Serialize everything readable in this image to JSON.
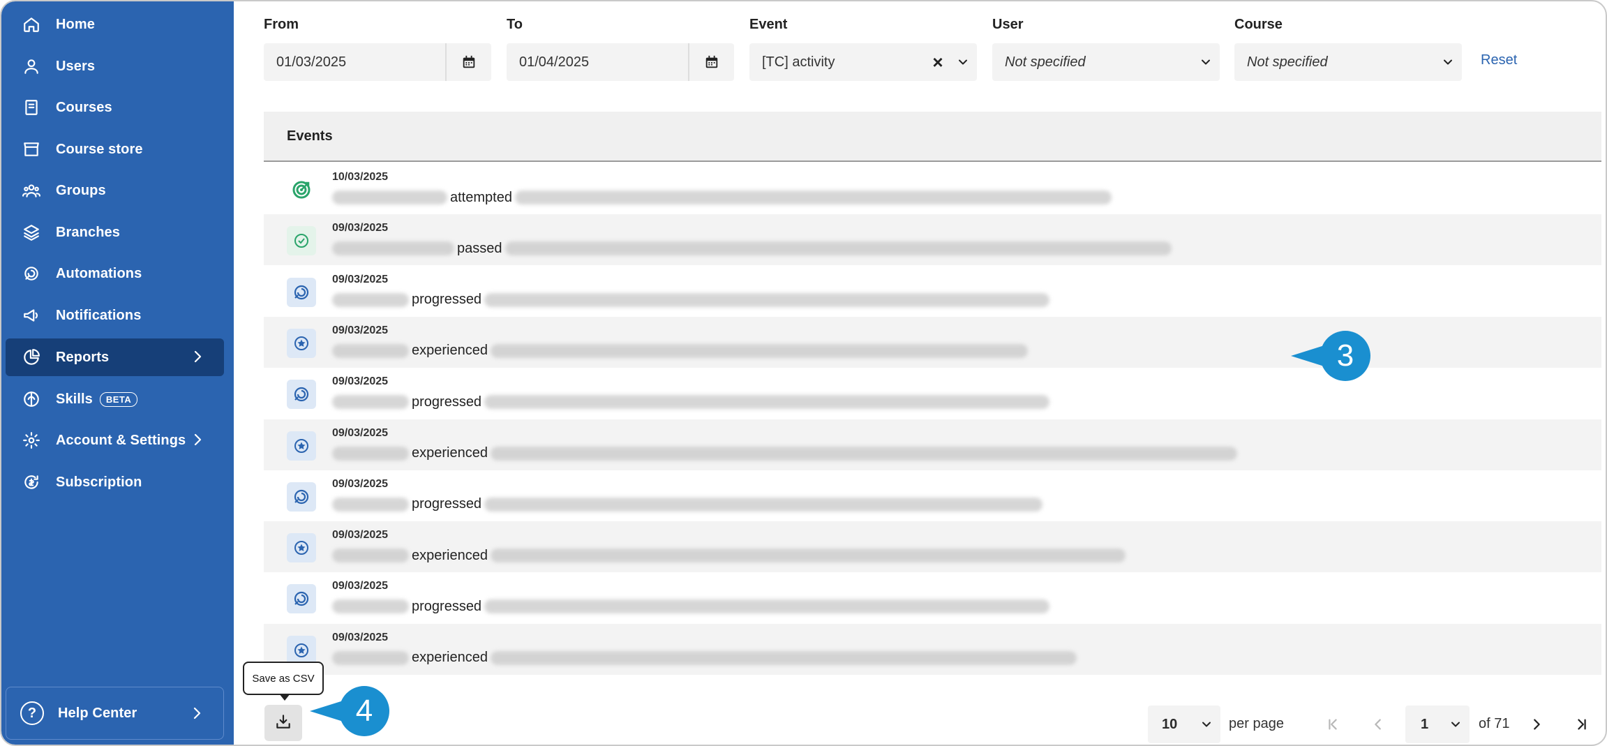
{
  "sidebar": {
    "items": [
      {
        "label": "Home",
        "icon": "home-icon"
      },
      {
        "label": "Users",
        "icon": "user-icon"
      },
      {
        "label": "Courses",
        "icon": "book-icon"
      },
      {
        "label": "Course store",
        "icon": "store-icon"
      },
      {
        "label": "Groups",
        "icon": "groups-icon"
      },
      {
        "label": "Branches",
        "icon": "layers-icon"
      },
      {
        "label": "Automations",
        "icon": "automation-icon"
      },
      {
        "label": "Notifications",
        "icon": "megaphone-icon"
      },
      {
        "label": "Reports",
        "icon": "pie-chart-icon"
      },
      {
        "label": "Skills",
        "icon": "skills-icon",
        "badge": "BETA"
      },
      {
        "label": "Account & Settings",
        "icon": "gear-icon"
      },
      {
        "label": "Subscription",
        "icon": "subscription-icon"
      }
    ],
    "help_center": "Help Center"
  },
  "filters": {
    "from_label": "From",
    "from_value": "01/03/2025",
    "to_label": "To",
    "to_value": "01/04/2025",
    "event_label": "Event",
    "event_value": "[TC] activity",
    "user_label": "User",
    "user_value": "Not specified",
    "course_label": "Course",
    "course_value": "Not specified",
    "reset": "Reset"
  },
  "events": {
    "header": "Events",
    "rows": [
      {
        "date": "10/03/2025",
        "verb": "attempted",
        "type": "target"
      },
      {
        "date": "09/03/2025",
        "verb": "passed",
        "type": "check"
      },
      {
        "date": "09/03/2025",
        "verb": "progressed",
        "type": "progress"
      },
      {
        "date": "09/03/2025",
        "verb": "experienced",
        "type": "star"
      },
      {
        "date": "09/03/2025",
        "verb": "progressed",
        "type": "progress"
      },
      {
        "date": "09/03/2025",
        "verb": "experienced",
        "type": "star"
      },
      {
        "date": "09/03/2025",
        "verb": "progressed",
        "type": "progress"
      },
      {
        "date": "09/03/2025",
        "verb": "experienced",
        "type": "star"
      },
      {
        "date": "09/03/2025",
        "verb": "progressed",
        "type": "progress"
      },
      {
        "date": "09/03/2025",
        "verb": "experienced",
        "type": "star"
      }
    ]
  },
  "callouts": {
    "rows": "3",
    "csv": "4"
  },
  "footer": {
    "tooltip": "Save as CSV",
    "per_page_value": "10",
    "per_page_label": "per page",
    "page_value": "1",
    "of_label": "of 71"
  },
  "colors": {
    "sidebar": "#2b64b0",
    "sidebar_active": "#163f78",
    "accent": "#2b64b0",
    "callout": "#1a8fd0",
    "success": "#2aa46a"
  }
}
